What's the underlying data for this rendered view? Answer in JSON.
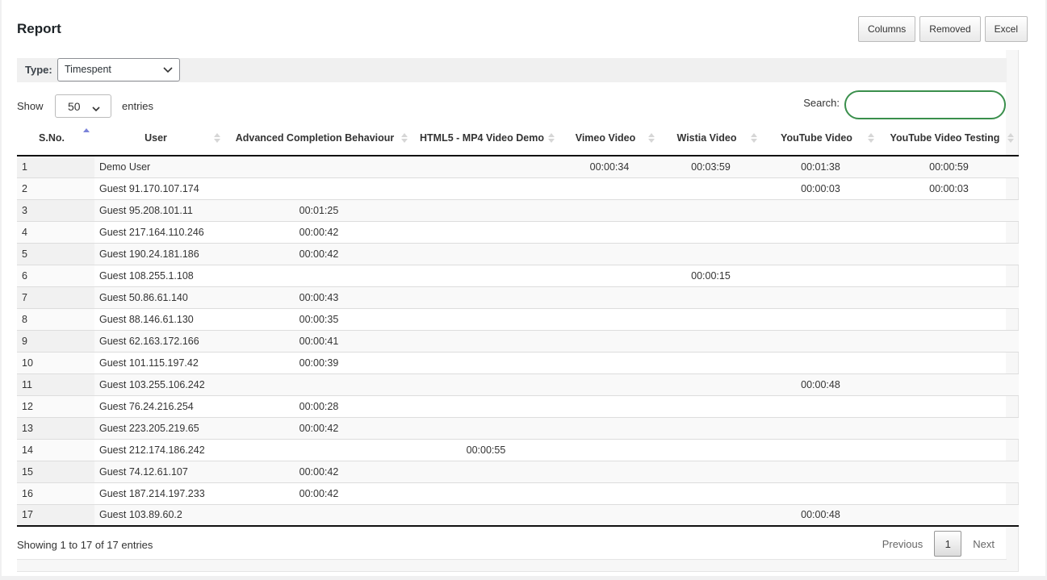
{
  "header": {
    "title": "Report",
    "buttons": {
      "columns": "Columns",
      "removed": "Removed",
      "excel": "Excel"
    }
  },
  "filter": {
    "type_label": "Type:",
    "type_value": "Timespent"
  },
  "length": {
    "show_label": "Show",
    "value": "50",
    "entries_label": "entries"
  },
  "search": {
    "label": "Search:",
    "value": "",
    "placeholder": ""
  },
  "table": {
    "columns": [
      {
        "label": "S.No.",
        "sort": "asc"
      },
      {
        "label": "User",
        "sort": "none"
      },
      {
        "label": "Advanced Completion Behaviour",
        "sort": "none"
      },
      {
        "label": "HTML5 - MP4 Video Demo",
        "sort": "none"
      },
      {
        "label": "Vimeo Video",
        "sort": "none"
      },
      {
        "label": "Wistia Video",
        "sort": "none"
      },
      {
        "label": "YouTube Video",
        "sort": "none"
      },
      {
        "label": "YouTube Video Testing",
        "sort": "none"
      }
    ],
    "rows": [
      [
        "1",
        "Demo User",
        "",
        "",
        "00:00:34",
        "00:03:59",
        "00:01:38",
        "00:00:59"
      ],
      [
        "2",
        "Guest 91.170.107.174",
        "",
        "",
        "",
        "",
        "00:00:03",
        "00:00:03"
      ],
      [
        "3",
        "Guest 95.208.101.11",
        "00:01:25",
        "",
        "",
        "",
        "",
        ""
      ],
      [
        "4",
        "Guest 217.164.110.246",
        "00:00:42",
        "",
        "",
        "",
        "",
        ""
      ],
      [
        "5",
        "Guest 190.24.181.186",
        "00:00:42",
        "",
        "",
        "",
        "",
        ""
      ],
      [
        "6",
        "Guest 108.255.1.108",
        "",
        "",
        "",
        "00:00:15",
        "",
        ""
      ],
      [
        "7",
        "Guest 50.86.61.140",
        "00:00:43",
        "",
        "",
        "",
        "",
        ""
      ],
      [
        "8",
        "Guest 88.146.61.130",
        "00:00:35",
        "",
        "",
        "",
        "",
        ""
      ],
      [
        "9",
        "Guest 62.163.172.166",
        "00:00:41",
        "",
        "",
        "",
        "",
        ""
      ],
      [
        "10",
        "Guest 101.115.197.42",
        "00:00:39",
        "",
        "",
        "",
        "",
        ""
      ],
      [
        "11",
        "Guest 103.255.106.242",
        "",
        "",
        "",
        "",
        "00:00:48",
        ""
      ],
      [
        "12",
        "Guest 76.24.216.254",
        "00:00:28",
        "",
        "",
        "",
        "",
        ""
      ],
      [
        "13",
        "Guest 223.205.219.65",
        "00:00:42",
        "",
        "",
        "",
        "",
        ""
      ],
      [
        "14",
        "Guest 212.174.186.242",
        "",
        "00:00:55",
        "",
        "",
        "",
        ""
      ],
      [
        "15",
        "Guest 74.12.61.107",
        "00:00:42",
        "",
        "",
        "",
        "",
        ""
      ],
      [
        "16",
        "Guest 187.214.197.233",
        "00:00:42",
        "",
        "",
        "",
        "",
        ""
      ],
      [
        "17",
        "Guest 103.89.60.2",
        "",
        "",
        "",
        "",
        "00:00:48",
        ""
      ]
    ]
  },
  "footer": {
    "info": "Showing 1 to 17 of 17 entries",
    "previous": "Previous",
    "current_page": "1",
    "next": "Next"
  },
  "colors": {
    "search_border": "#3a8f4c",
    "sort_active": "#7b83d9",
    "sort_inactive": "#d6d6d6"
  }
}
